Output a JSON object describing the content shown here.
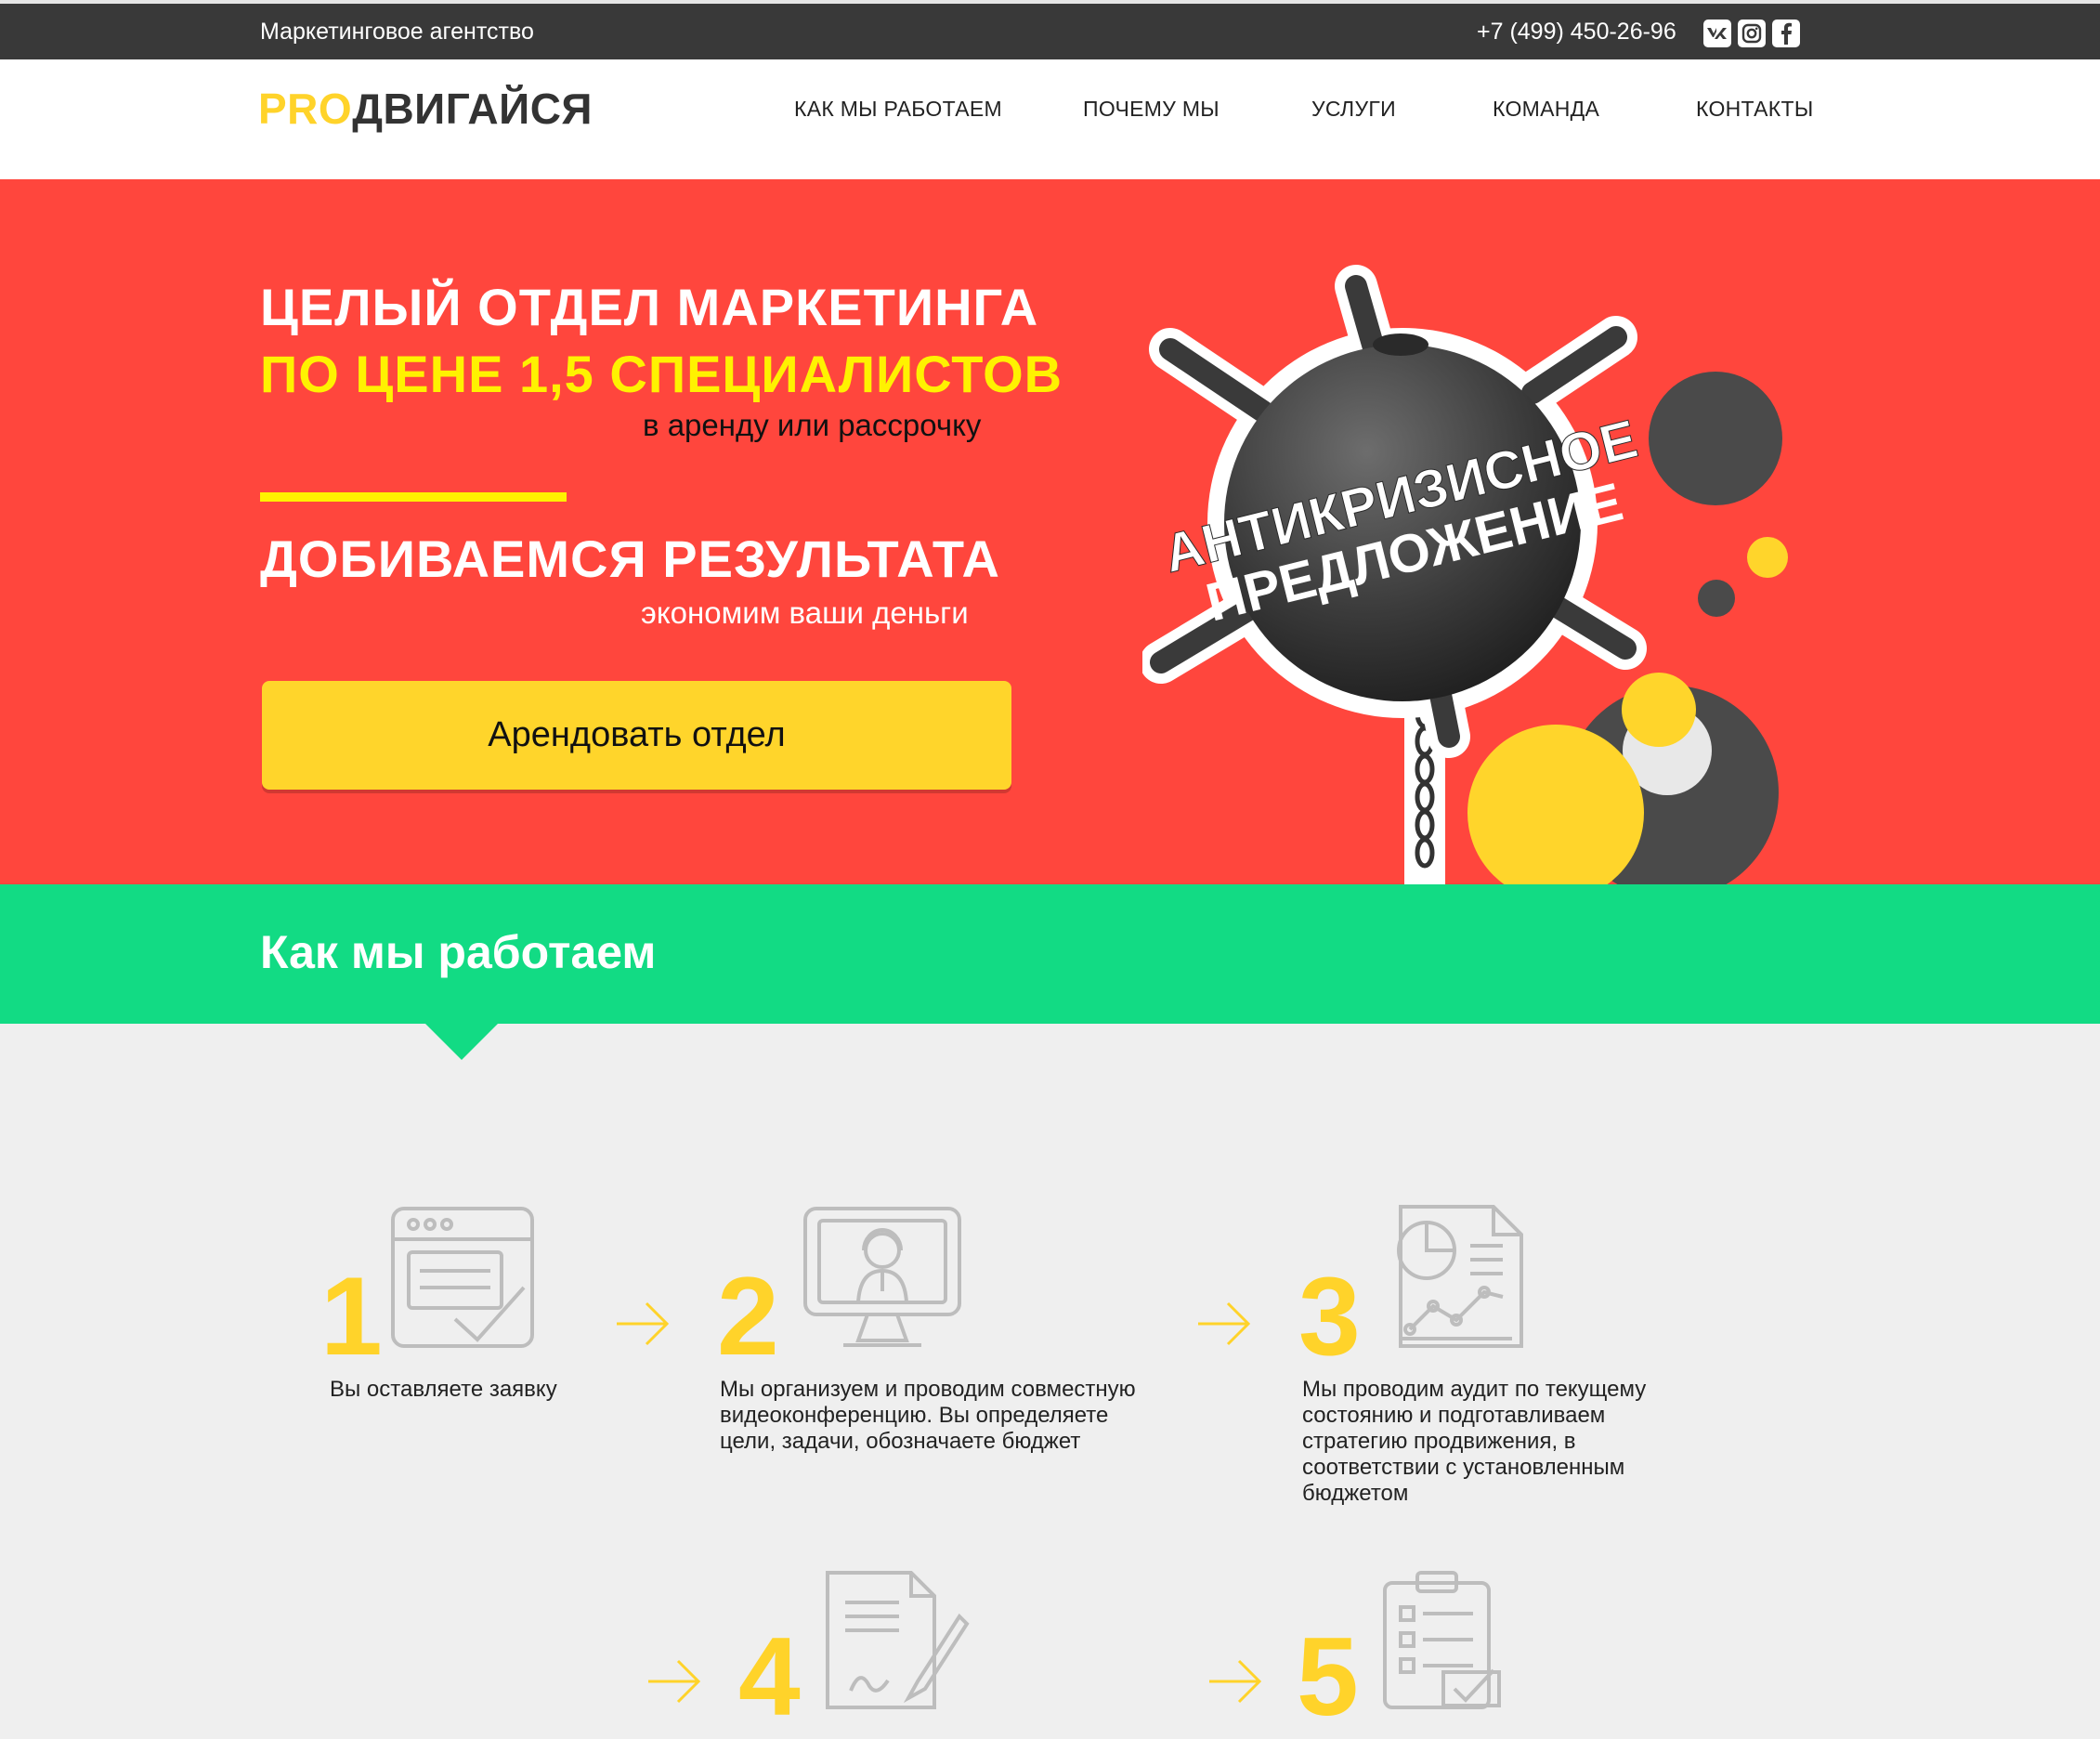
{
  "topbar": {
    "tagline": "Маркетинговое агентство",
    "phone": "+7 (499) 450-26-96",
    "social": [
      {
        "icon": "vk-icon",
        "label": "vk"
      },
      {
        "icon": "instagram-icon",
        "label": ""
      },
      {
        "icon": "facebook-icon",
        "label": "f"
      }
    ]
  },
  "header": {
    "logo_pro": "PRO",
    "logo_rest": "ДВИГАЙСЯ",
    "nav": [
      "КАК МЫ РАБОТАЕМ",
      "ПОЧЕМУ МЫ",
      "УСЛУГИ",
      "КОМАНДА",
      "КОНТАКТЫ"
    ]
  },
  "hero": {
    "line1": "ЦЕЛЫЙ ОТДЕЛ МАРКЕТИНГА",
    "line2": "ПО ЦЕНЕ 1,5 СПЕЦИАЛИСТОВ",
    "line3": "в аренду или рассрочку",
    "line4": "ДОБИВАЕМСЯ РЕЗУЛЬТАТА",
    "line5": "экономим ваши деньги",
    "cta": "Арендовать отдел",
    "badge_line1": "АНТИКРИЗИСНОЕ",
    "badge_line2": "ПРЕДЛОЖЕНИЕ",
    "colors": {
      "background": "#ff463d",
      "yellow": "#fff200",
      "button": "#ffd52b"
    }
  },
  "how": {
    "title": "Как мы работаем",
    "accent": "#12db84",
    "steps": [
      {
        "num": "1",
        "icon": "form-check-icon",
        "text": "Вы оставляете заявку"
      },
      {
        "num": "2",
        "icon": "video-conference-icon",
        "text": "Мы организуем и проводим совместную видеоконференцию. Вы определяете цели, задачи, обозначаете бюджет"
      },
      {
        "num": "3",
        "icon": "audit-report-icon",
        "text": "Мы проводим аудит по текущему состоянию и подготавливаем стратегию продвижения, в соответствии с установленным бюджетом"
      },
      {
        "num": "4",
        "icon": "contract-sign-icon",
        "text": ""
      },
      {
        "num": "5",
        "icon": "checklist-icon",
        "text": ""
      }
    ]
  }
}
